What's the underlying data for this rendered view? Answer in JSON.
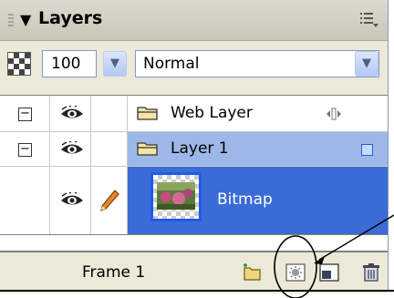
{
  "panel": {
    "title": "Layers"
  },
  "toolbar": {
    "opacity_value": "100",
    "blend_mode": "Normal"
  },
  "layers": [
    {
      "name": "Web Layer"
    },
    {
      "name": "Layer 1"
    },
    {
      "name": "Bitmap"
    }
  ],
  "footer": {
    "frame_label": "Frame 1"
  },
  "colors": {
    "selection": "#3a6bd6",
    "layer_highlight": "#9db8e8"
  }
}
